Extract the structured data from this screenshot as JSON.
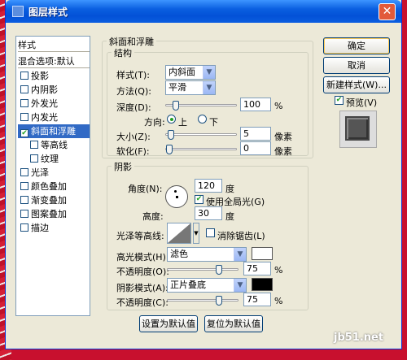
{
  "window": {
    "title": "图层样式",
    "close": "✕"
  },
  "styles_list": {
    "header": "样式",
    "blend": "混合选项:默认",
    "items": [
      {
        "label": "投影",
        "checked": false
      },
      {
        "label": "内阴影",
        "checked": false
      },
      {
        "label": "外发光",
        "checked": false
      },
      {
        "label": "内发光",
        "checked": false
      },
      {
        "label": "斜面和浮雕",
        "checked": true,
        "selected": true
      },
      {
        "label": "等高线",
        "checked": false,
        "sub": true
      },
      {
        "label": "纹理",
        "checked": false,
        "sub": true
      },
      {
        "label": "光泽",
        "checked": false
      },
      {
        "label": "颜色叠加",
        "checked": false
      },
      {
        "label": "渐变叠加",
        "checked": false
      },
      {
        "label": "图案叠加",
        "checked": false
      },
      {
        "label": "描边",
        "checked": false
      }
    ]
  },
  "bevel": {
    "group_title": "斜面和浮雕",
    "structure_title": "结构",
    "style_label": "样式(T):",
    "style_value": "内斜面",
    "technique_label": "方法(Q):",
    "technique_value": "平滑",
    "depth_label": "深度(D):",
    "depth_value": "100",
    "depth_unit": "%",
    "direction_label": "方向:",
    "dir_up": "上",
    "dir_down": "下",
    "size_label": "大小(Z):",
    "size_value": "5",
    "size_unit": "像素",
    "soften_label": "软化(F):",
    "soften_value": "0",
    "soften_unit": "像素",
    "depth_fraction": 0.1,
    "size_fraction": 0.02,
    "soften_fraction": 0.0
  },
  "shading": {
    "title": "阴影",
    "angle_label": "角度(N):",
    "angle_value": "120",
    "angle_unit": "度",
    "global_light_label": "使用全局光(G)",
    "altitude_label": "高度:",
    "altitude_value": "30",
    "altitude_unit": "度",
    "gloss_label": "光泽等高线:",
    "antialias_label": "消除锯齿(L)",
    "highlight_mode_label": "高光模式(H):",
    "highlight_mode_value": "滤色",
    "highlight_color": "#ffffff",
    "highlight_opacity_label": "不透明度(O):",
    "highlight_opacity_value": "75",
    "highlight_opacity_unit": "%",
    "shadow_mode_label": "阴影模式(A):",
    "shadow_mode_value": "正片叠底",
    "shadow_color": "#000000",
    "shadow_opacity_label": "不透明度(C):",
    "shadow_opacity_value": "75",
    "shadow_opacity_unit": "%",
    "opacity_fraction": 0.75
  },
  "buttons": {
    "ok": "确定",
    "cancel": "取消",
    "new_style": "新建样式(W)...",
    "preview": "预览(V)",
    "make_default": "设置为默认值",
    "reset_default": "复位为默认值"
  },
  "watermark": {
    "site": "jb51.net"
  }
}
